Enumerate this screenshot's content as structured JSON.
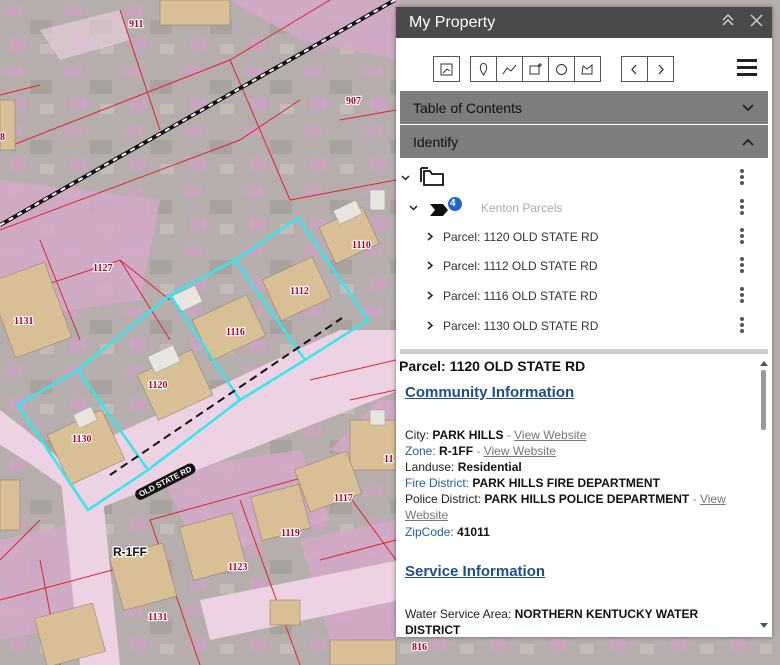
{
  "map": {
    "parcel_labels": [
      "911",
      "907",
      "8",
      "1127",
      "1110",
      "1112",
      "1116",
      "1131",
      "1120",
      "1130",
      "11",
      "1117",
      "1119",
      "1123",
      "1131",
      "816",
      "1118"
    ],
    "zone_label": "R-1FF",
    "road_label": "OLD STATE RD"
  },
  "panel": {
    "title": "My Property",
    "toolbar": {
      "tools": [
        "extent-icon",
        "point-icon",
        "polyline-icon",
        "rectangle-icon",
        "circle-icon",
        "polygon-icon"
      ],
      "nav": [
        "prev-icon",
        "next-icon"
      ]
    },
    "accordions": {
      "toc": "Table of Contents",
      "identify": "Identify"
    },
    "layer": {
      "name": "Kenton Parcels",
      "count": "4"
    },
    "parcels": [
      "Parcel: 1120 OLD STATE RD",
      "Parcel: 1112 OLD STATE RD",
      "Parcel: 1116 OLD STATE RD",
      "Parcel: 1130 OLD STATE RD"
    ],
    "details": {
      "header": "Parcel: 1120 OLD STATE RD",
      "community_title": "Community Information",
      "city_label": "City:",
      "city": "PARK HILLS",
      "zone_label": "Zone:",
      "zone": "R-1FF",
      "view_website": "View Website",
      "landuse_label": "Landuse:",
      "landuse": "Residential",
      "fire_label": "Fire District:",
      "fire": "PARK HILLS FIRE DEPARTMENT",
      "police_label": "Police District:",
      "police": "PARK HILLS POLICE DEPARTMENT",
      "police_link_1": "View",
      "police_link_2": "Website",
      "zip_label": "ZipCode:",
      "zip": "41011",
      "service_title": "Service Information",
      "water_label": "Water Service Area:",
      "water_1": "NORTHERN KENTUCKY WATER",
      "water_2": "DISTRICT"
    }
  },
  "colors": {
    "titlebar": "#4a4a4a",
    "accordion": "#7d7d7d",
    "link_blue": "#1f4e8c",
    "selection": "#34e6ef",
    "parcel_line": "#e0242e"
  }
}
